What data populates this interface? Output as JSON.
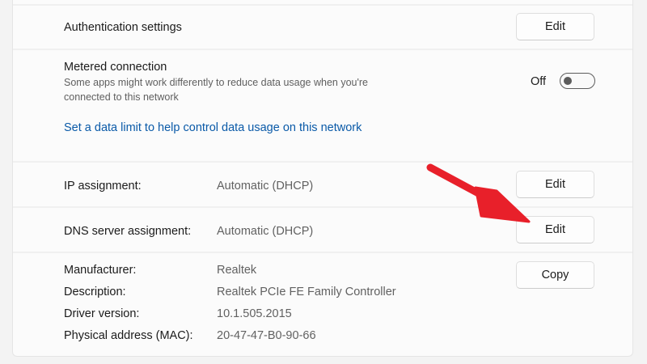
{
  "authentication": {
    "label": "Authentication settings",
    "button": "Edit"
  },
  "metered": {
    "title": "Metered connection",
    "description_line1": "Some apps might work differently to reduce data usage when you're",
    "description_line2": "connected to this network",
    "toggle_state": "Off",
    "toggle_on": false,
    "data_limit_link": "Set a data limit to help control data usage on this network"
  },
  "ip_assignment": {
    "label": "IP assignment:",
    "value": "Automatic (DHCP)",
    "button": "Edit"
  },
  "dns_assignment": {
    "label": "DNS server assignment:",
    "value": "Automatic (DHCP)",
    "button": "Edit"
  },
  "properties": {
    "button": "Copy",
    "rows": [
      {
        "label": "Manufacturer:",
        "value": "Realtek"
      },
      {
        "label": "Description:",
        "value": "Realtek PCIe FE Family Controller"
      },
      {
        "label": "Driver version:",
        "value": "10.1.505.2015"
      },
      {
        "label": "Physical address (MAC):",
        "value": "20-47-47-B0-90-66"
      }
    ]
  },
  "colors": {
    "link": "#0a5aa8",
    "annotation_arrow": "#e8202a",
    "panel_background": "#fbfbfb",
    "page_background": "#f3f3f3"
  }
}
